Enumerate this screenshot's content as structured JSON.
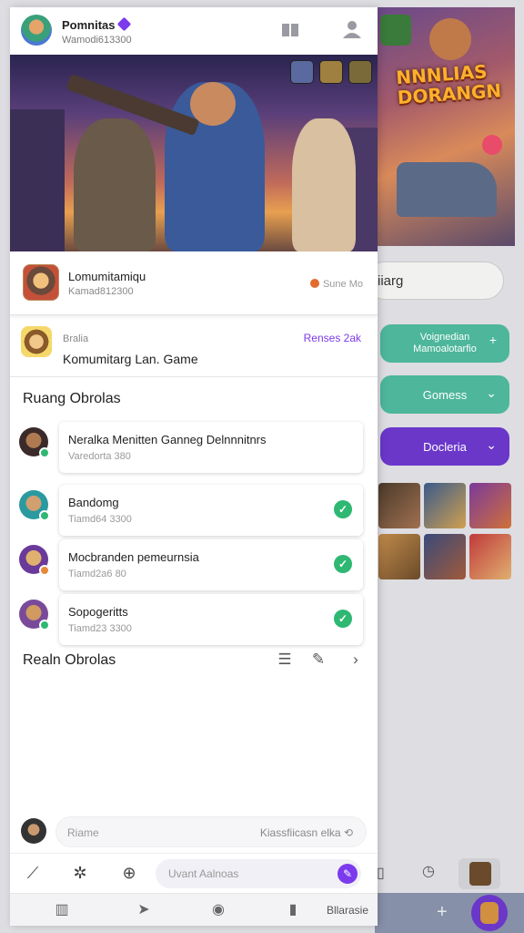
{
  "header": {
    "profile_name": "Pomnitas",
    "profile_sub": "Wamodi613300"
  },
  "game": {
    "title": "Lomumitamiqu",
    "subtitle": "Kamad812300",
    "status": "Sune Mo"
  },
  "community": {
    "small_label": "Bralia",
    "title": "Komumitarg Lan. Game",
    "link": "Renses 2ak"
  },
  "chat_section": {
    "title": "Ruang Obrolas",
    "rows": [
      {
        "name": "Neralka Menitten Ganneg Delnnnitnrs",
        "meta": "Varedorta 380",
        "checked": false
      },
      {
        "name": "Bandomg",
        "meta": "Tiamd64 3300",
        "checked": true
      },
      {
        "name": "Mocbranden pemeurnsia",
        "meta": "Tiamd2a6 80",
        "checked": true
      },
      {
        "name": "Sopogeritts",
        "meta": "Tiamd23 3300",
        "checked": true
      }
    ]
  },
  "recent": {
    "title": "Realn Obrolas"
  },
  "compose": {
    "placeholder": "Riame",
    "right_text": "Kiassfiicasn elka"
  },
  "message": {
    "placeholder": "Uvant Aalnoas"
  },
  "nav": {
    "label": "Bllarasie"
  },
  "background": {
    "banner_title": "NNNLIAS DORANGN",
    "search_text": "iiarg",
    "pills": [
      {
        "label": "Voignedian Mamoalotarfio",
        "color": "#4db69b"
      },
      {
        "label": "Gomess",
        "color": "#4db69b"
      },
      {
        "label": "Docleria",
        "color": "#6a37c9"
      }
    ]
  },
  "colors": {
    "accent": "#7c3aed",
    "success": "#2eb872",
    "teal": "#4db69b"
  }
}
